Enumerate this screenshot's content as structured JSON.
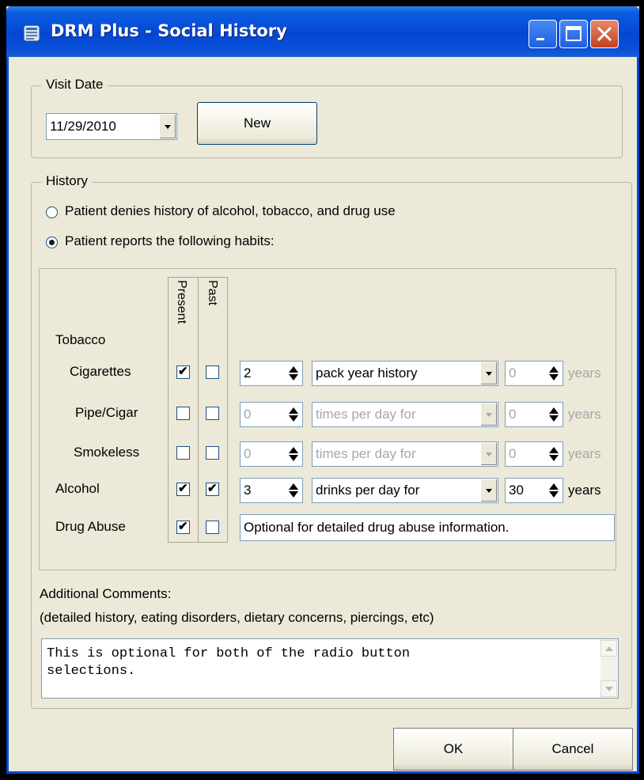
{
  "window": {
    "title": "DRM Plus - Social History"
  },
  "visit_date": {
    "legend": "Visit Date",
    "date_value": "11/29/2010",
    "new_label": "New"
  },
  "history": {
    "legend": "History",
    "option_denies": "Patient denies history of alcohol, tobacco, and drug use",
    "option_reports": "Patient reports the following habits:",
    "selected": "reports",
    "col_present": "Present",
    "col_past": "Past",
    "tobacco_label": "Tobacco",
    "rows": {
      "cigarettes": {
        "label": "Cigarettes",
        "present": true,
        "past": false,
        "amount": "2",
        "unit": "pack year history",
        "duration": "0",
        "years": "years",
        "enabled": true,
        "duration_enabled": false
      },
      "pipe": {
        "label": "Pipe/Cigar",
        "present": false,
        "past": false,
        "amount": "0",
        "unit": "times per day for",
        "duration": "0",
        "years": "years",
        "enabled": false
      },
      "smokeless": {
        "label": "Smokeless",
        "present": false,
        "past": false,
        "amount": "0",
        "unit": "times per day for",
        "duration": "0",
        "years": "years",
        "enabled": false
      },
      "alcohol": {
        "label": "Alcohol",
        "present": true,
        "past": true,
        "amount": "3",
        "unit": "drinks per day for",
        "duration": "30",
        "years": "years",
        "enabled": true
      },
      "drugs": {
        "label": "Drug Abuse",
        "present": true,
        "past": false,
        "info": "Optional for detailed drug abuse information."
      }
    },
    "comments_label_1": "Additional Comments:",
    "comments_label_2": "(detailed history, eating disorders, dietary concerns, piercings, etc)",
    "comments_text": "This is optional for both of the radio button\nselections."
  },
  "buttons": {
    "ok": "OK",
    "cancel": "Cancel"
  },
  "check_mark": "✔"
}
